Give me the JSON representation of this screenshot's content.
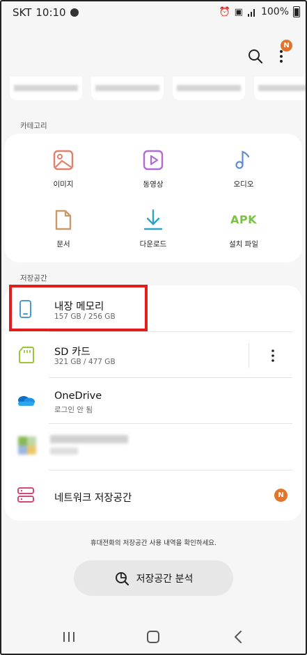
{
  "status_bar": {
    "carrier": "SKT",
    "time": "10:10",
    "battery": "100%",
    "icons": [
      "alarm-icon",
      "vowifi-icon",
      "signal-icon",
      "battery-icon"
    ]
  },
  "header": {
    "search_icon": "search-icon",
    "more_icon": "more-vertical-icon",
    "notification_badge": "N"
  },
  "categories": {
    "section_label": "카테고리",
    "items": [
      {
        "label": "이미지",
        "icon": "image-icon",
        "color": "#e07f6c"
      },
      {
        "label": "동영상",
        "icon": "video-icon",
        "color": "#b06ad6"
      },
      {
        "label": "오디오",
        "icon": "music-note-icon",
        "color": "#5b8dd6"
      },
      {
        "label": "문서",
        "icon": "document-icon",
        "color": "#c79a6a"
      },
      {
        "label": "다운로드",
        "icon": "download-icon",
        "color": "#2aa3c4"
      },
      {
        "label": "설치 파일",
        "icon": "apk-icon",
        "text": "APK",
        "color": "#7cc143"
      }
    ]
  },
  "storage": {
    "section_label": "저장공간",
    "items": [
      {
        "title": "내장 메모리",
        "subtitle": "157 GB / 256 GB",
        "icon": "phone-icon"
      },
      {
        "title": "SD 카드",
        "subtitle": "321 GB / 477 GB",
        "icon": "sd-card-icon"
      },
      {
        "title": "OneDrive",
        "subtitle": "로그인 안 됨",
        "icon": "onedrive-icon"
      },
      {
        "title": "네트워크 저장공간",
        "icon": "network-storage-icon",
        "badge": "N"
      }
    ]
  },
  "footer": {
    "note": "휴대전화의 저장공간 사용 내역을 확인하세요.",
    "analyze_button": "저장공간 분석"
  },
  "nav": {
    "recents": "recents-icon",
    "home": "home-icon",
    "back": "back-icon"
  },
  "colors": {
    "accent_badge": "#e2742b",
    "highlight": "#e31c1c",
    "background": "#f6f6f6"
  }
}
